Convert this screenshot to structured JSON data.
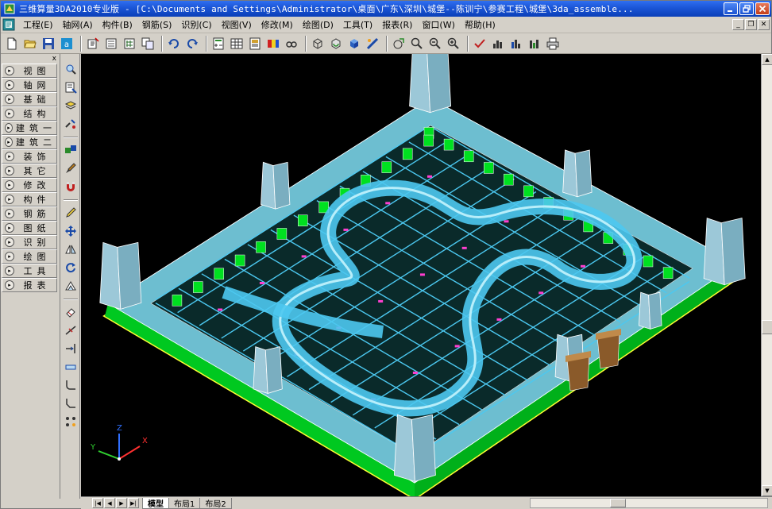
{
  "window": {
    "title": "三维算量3DA2010专业版 - [C:\\Documents and Settings\\Administrator\\桌面\\广东\\深圳\\城堡--陈训宁\\参赛工程\\城堡\\3da_assemble..."
  },
  "menu": {
    "items": [
      {
        "label": "工程(E)"
      },
      {
        "label": "轴网(A)"
      },
      {
        "label": "构件(B)"
      },
      {
        "label": "钢筋(S)"
      },
      {
        "label": "识别(C)"
      },
      {
        "label": "视图(V)"
      },
      {
        "label": "修改(M)"
      },
      {
        "label": "绘图(D)"
      },
      {
        "label": "工具(T)"
      },
      {
        "label": "报表(R)"
      },
      {
        "label": "窗口(W)"
      },
      {
        "label": "帮助(H)"
      }
    ]
  },
  "toolbar": {
    "icons": [
      "new-file-icon",
      "open-folder-icon",
      "save-icon",
      "app-icon",
      "import-icon",
      "export-icon",
      "settings-icon",
      "copy-icon",
      "undo-icon",
      "redo-icon",
      "calculate-icon",
      "table-icon",
      "report-icon",
      "legend-icon",
      "find-icon",
      "3d-box-icon",
      "3d-rotate-icon",
      "solid-icon",
      "render-icon",
      "pan-icon",
      "zoom-window-icon",
      "zoom-out-icon",
      "zoom-extent-icon",
      "check-icon",
      "stats-bar-icon",
      "stats-bar-2-icon",
      "stats-bar-3-icon",
      "print-icon"
    ]
  },
  "left_panel": {
    "close_label": "x",
    "items": [
      {
        "label": "视图"
      },
      {
        "label": "轴网"
      },
      {
        "label": "基础"
      },
      {
        "label": "结构"
      },
      {
        "label": "建筑一"
      },
      {
        "label": "建筑二"
      },
      {
        "label": "装饰"
      },
      {
        "label": "其它"
      },
      {
        "label": "修改"
      },
      {
        "label": "构件"
      },
      {
        "label": "钢筋"
      },
      {
        "label": "图纸"
      },
      {
        "label": "识别"
      },
      {
        "label": "绘图"
      },
      {
        "label": "工具"
      },
      {
        "label": "报表"
      }
    ]
  },
  "side_toolbar": {
    "icons": [
      "select-icon",
      "properties-icon",
      "layer-icon",
      "match-icon",
      "copy-props-icon",
      "brush-icon",
      "magnet-icon",
      "pencil-icon",
      "move-icon",
      "mirror-icon",
      "rotate-icon",
      "scale-icon",
      "erase-icon",
      "trim-icon",
      "extend-icon",
      "break-icon",
      "fillet-icon",
      "chamfer-icon",
      "array-icon"
    ]
  },
  "viewport": {
    "axes": {
      "x": "X",
      "y": "Y",
      "z": "Z"
    },
    "colors": {
      "background": "#000000",
      "slab": "#7fd8ee",
      "beam": "#4cc8f0",
      "wall": "#00e020",
      "edge": "#ffffff",
      "rebar": "#ff3fd0",
      "base": "#ffff33",
      "tower": "#9cc8d8",
      "brick": "#8a5a2a"
    }
  },
  "layout_tabs": {
    "tabs": [
      {
        "label": "模型",
        "active": true
      },
      {
        "label": "布局1",
        "active": false
      },
      {
        "label": "布局2",
        "active": false
      }
    ]
  }
}
